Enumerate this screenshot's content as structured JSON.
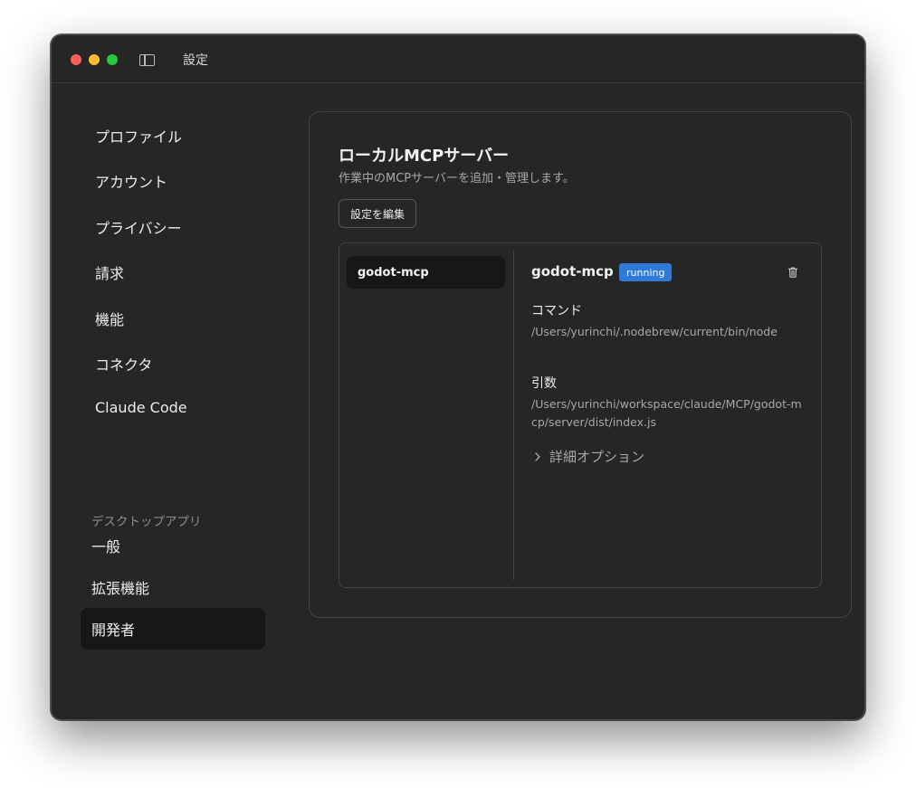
{
  "window": {
    "title": "設定"
  },
  "nav": {
    "items": [
      "プロファイル",
      "アカウント",
      "プライバシー",
      "請求",
      "機能",
      "コネクタ",
      "Claude Code"
    ],
    "section_label": "デスクトップアプリ",
    "desktop_items": [
      "一般",
      "拡張機能",
      "開発者"
    ]
  },
  "panel": {
    "title": "ローカルMCPサーバー",
    "subtitle": "作業中のMCPサーバーを追加・管理します。",
    "edit_button": "設定を編集",
    "servers": [
      "godot-mcp"
    ],
    "detail": {
      "name": "godot-mcp",
      "status": "running",
      "command_label": "コマンド",
      "command_value": "/Users/yurinchi/.nodebrew/current/bin/node",
      "args_label": "引数",
      "args_value": "/Users/yurinchi/workspace/claude/MCP/godot-mcp/server/dist/index.js",
      "advanced_label": "詳細オプション"
    }
  },
  "colors": {
    "accent": "#2f7ad6",
    "window_bg": "#262626",
    "active_bg": "#171717"
  }
}
